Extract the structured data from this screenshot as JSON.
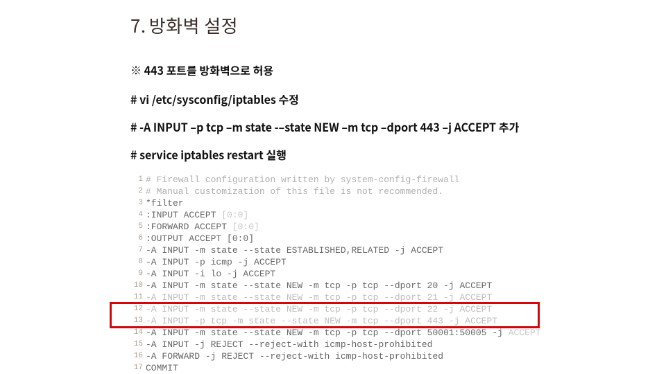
{
  "heading": {
    "num": "7.",
    "title": "방화벽 설정"
  },
  "note": "※  443 포트를 방화벽으로 허용",
  "cmds": {
    "c1": "# vi /etc/sysconfig/iptables 수정",
    "c2": "# -A INPUT –p tcp –m state -–state NEW –m tcp –dport 443 –j ACCEPT 추가",
    "c3": "# service iptables restart 실행"
  },
  "code": {
    "l1": "# Firewall configuration written by system-config-firewall",
    "l2": "# Manual customization of this file is not recommended.",
    "l3": "*filter",
    "l4a": ":INPUT ACCEPT ",
    "l4b": "[0:0]",
    "l5a": ":FORWARD ACCEPT ",
    "l5b": "[0:0]",
    "l6": ":OUTPUT ACCEPT [0:0]",
    "l7": "-A INPUT -m state --state ESTABLISHED,RELATED -j ACCEPT",
    "l8": "-A INPUT -p icmp -j ACCEPT",
    "l9": "-A INPUT -i lo -j ACCEPT",
    "l10": "-A INPUT -m state --state NEW -m tcp -p tcp --dport 20 -j ACCEPT",
    "l11": "-A INPUT -m state --state NEW -m tcp -p tcp --dport 21 -j ACCEPT",
    "l12": "-A INPUT -m state --state NEW -m tcp -p tcp --dport 22 -j ACCEPT",
    "l13": "-A INPUT -p tcp -m state --state NEW -m tcp --dport 443 -j ACCEPT",
    "l14a": "-A INPUT -m state --state NEW -m tcp -p tcp --dport 50001:50005 -j",
    "l14b": " ACCEPT",
    "l15": "-A INPUT -j REJECT --reject-with icmp-host-prohibited",
    "l16": "-A FORWARD -j REJECT --reject-with icmp-host-prohibited",
    "l17": "COMMIT"
  },
  "gutter": {
    "g1": "1",
    "g2": "2",
    "g3": "3",
    "g4": "4",
    "g5": "5",
    "g6": "6",
    "g7": "7",
    "g8": "8",
    "g9": "9",
    "g10": "10",
    "g11": "11",
    "g12": "12",
    "g13": "13",
    "g14": "14",
    "g15": "15",
    "g16": "16",
    "g17": "17"
  }
}
